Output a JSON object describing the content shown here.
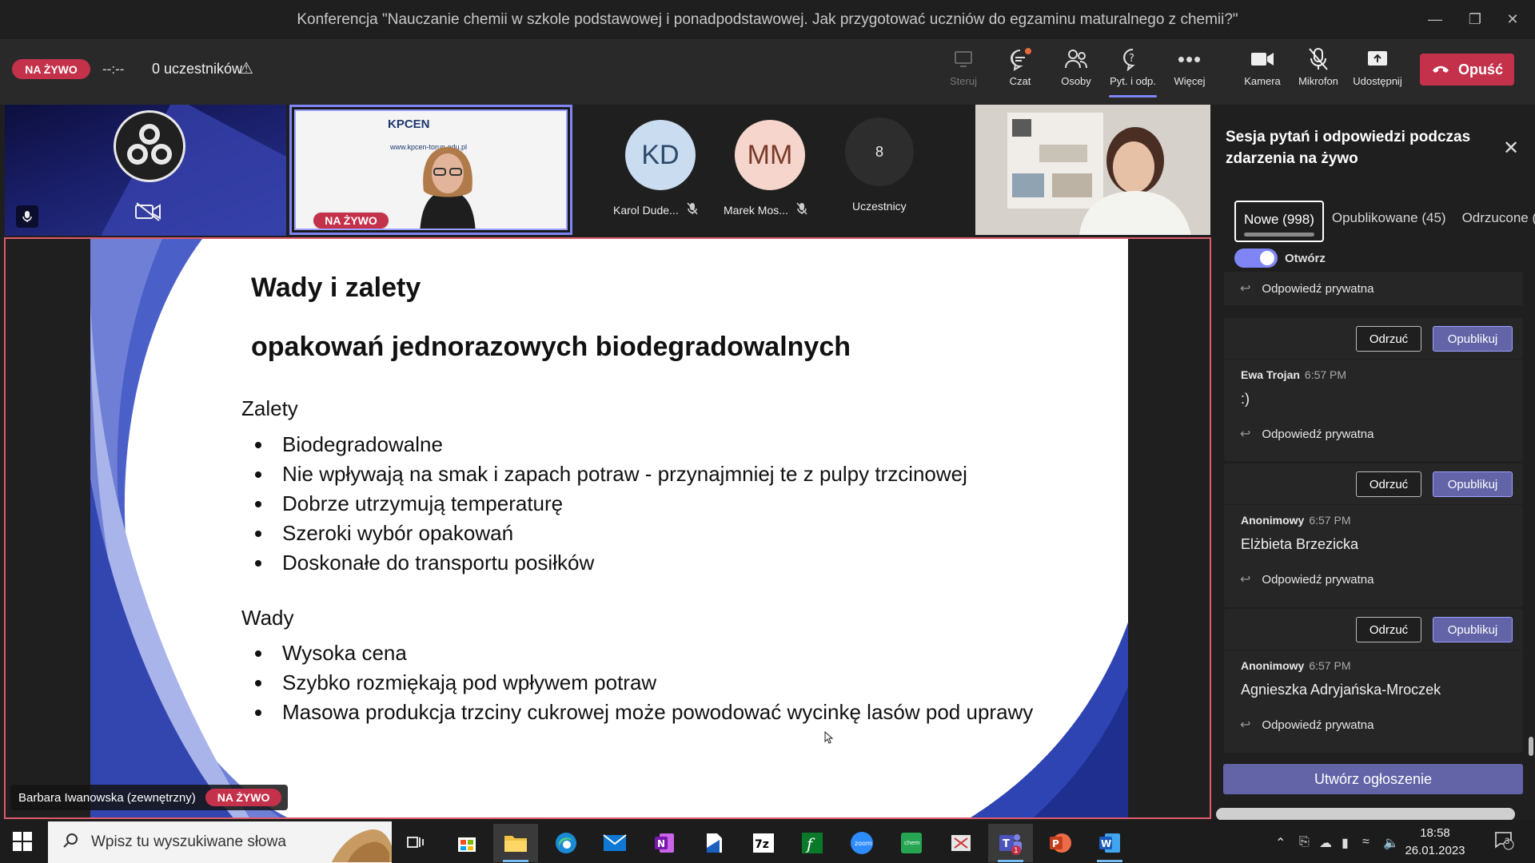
{
  "window": {
    "title": "Konferencja \"Nauczanie chemii w szkole podstawowej i ponadpodstawowej. Jak przygotować uczniów do egzaminu maturalnego z chemii?\""
  },
  "toolbar": {
    "live": "NA ŻYWO",
    "timer": "--:--",
    "participants": "0 uczestników",
    "buttons": {
      "share_control": "Steruj",
      "chat": "Czat",
      "people": "Osoby",
      "qa": "Pyt. i odp.",
      "more": "Więcej",
      "camera": "Kamera",
      "mic": "Mikrofon",
      "share": "Udostępnij"
    },
    "leave": "Opuść"
  },
  "videos": {
    "kpcen_logo": "KPCEN",
    "kpcen_url": "www.kpcen-torun.edu.pl",
    "kpcen_live": "NA ŻYWO",
    "participants": [
      {
        "initials": "KD",
        "name": "Karol Dude...",
        "color": "#c9dcf0",
        "text_color": "#2c4a6b"
      },
      {
        "initials": "MM",
        "name": "Marek Mos...",
        "color": "#f6d6cc",
        "text_color": "#7a3b2a"
      }
    ],
    "others_count": "8",
    "others_label": "Uczestnicy"
  },
  "slide": {
    "title_line1": "Wady i zalety",
    "title_line2": "opakowań jednorazowych biodegradowalnych",
    "pros_heading": "Zalety",
    "pros": [
      "Biodegradowalne",
      "Nie wpływają na smak i zapach potraw - przynajmniej te z pulpy trzcinowej",
      "Dobrze utrzymują temperaturę",
      "Szeroki wybór opakowań",
      "Doskonałe do transportu posiłków"
    ],
    "cons_heading": "Wady",
    "cons": [
      "Wysoka cena",
      "Szybko rozmiękają pod wpływem potraw",
      "Masowa produkcja trzciny cukrowej może powodować wycinkę lasów pod uprawy"
    ],
    "presenter": "Barbara Iwanowska (zewnętrzny)",
    "presenter_live": "NA ŻYWO"
  },
  "qa": {
    "title": "Sesja pytań i odpowiedzi podczas zdarzenia na żywo",
    "tabs": [
      "Nowe (998)",
      "Opublikowane (45)",
      "Odrzucone ("
    ],
    "toggle_label": "Otwórz",
    "private_reply": "Odpowiedź prywatna",
    "reject": "Odrzuć",
    "publish": "Opublikuj",
    "questions": [
      {
        "author": "Ewa Trojan",
        "time": "6:57 PM",
        "text": ":)"
      },
      {
        "author": "Anonimowy",
        "time": "6:57 PM",
        "text": "Elżbieta Brzezicka"
      },
      {
        "author": "Anonimowy",
        "time": "6:57 PM",
        "text": "Agnieszka Adryjańska-Mroczek"
      }
    ],
    "announce": "Utwórz ogłoszenie"
  },
  "taskbar": {
    "search_placeholder": "Wpisz tu wyszukiwane słowa",
    "time": "18:58",
    "date": "26.01.2023",
    "notifications": "3"
  },
  "colors": {
    "live_red": "#c4314b",
    "accent": "#6264a7",
    "accent_light": "#7f85f5"
  }
}
